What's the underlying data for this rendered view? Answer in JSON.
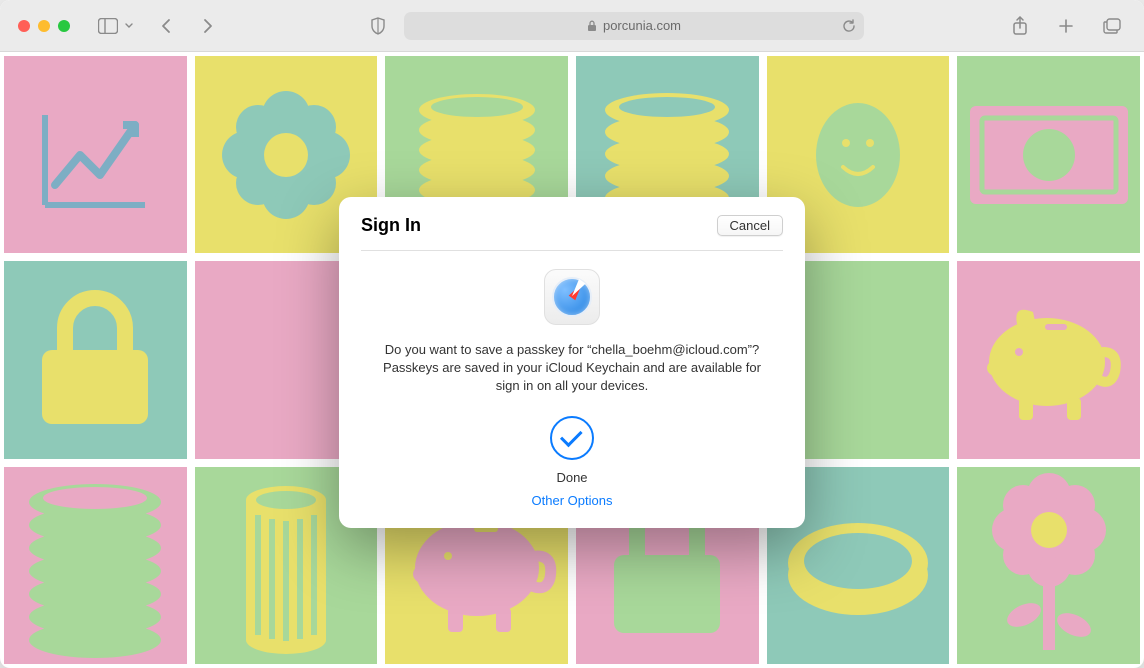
{
  "browser": {
    "url_display": "porcunia.com"
  },
  "modal": {
    "title": "Sign In",
    "cancel_label": "Cancel",
    "body_text": "Do you want to save a passkey for “chella_boehm@icloud.com”? Passkeys are saved in your iCloud Keychain and are available for sign in on all your devices.",
    "done_label": "Done",
    "other_options_label": "Other Options"
  }
}
